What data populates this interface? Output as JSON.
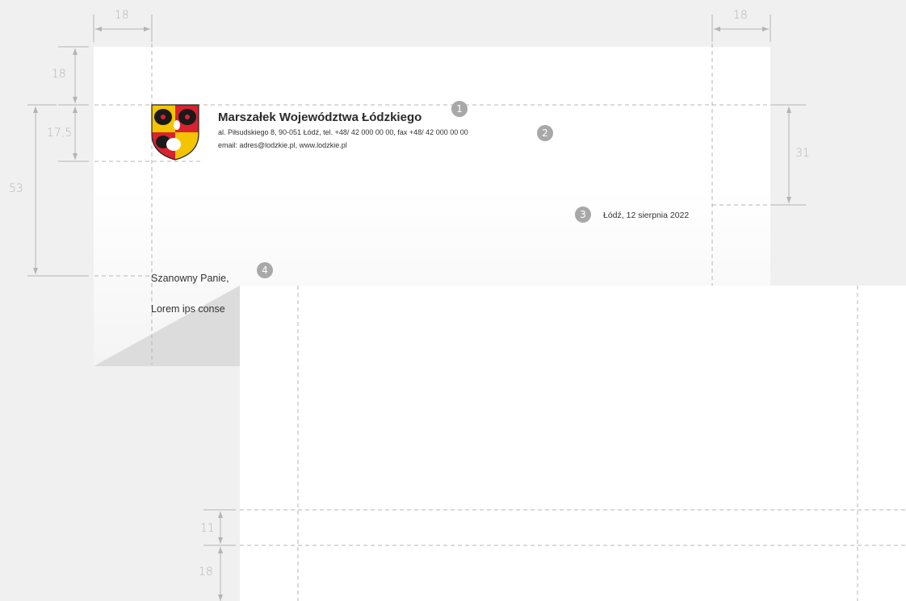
{
  "dimensions": {
    "left_margin_top": "18",
    "right_margin_top": "18",
    "top_margin": "18",
    "header_height": "17,5",
    "salutation_offset": "53",
    "date_offset": "31",
    "footer_gap": "11",
    "bottom_margin": "18"
  },
  "badges": [
    "1",
    "2",
    "3",
    "4"
  ],
  "letterhead": {
    "org_name": "Marszałek Województwa Łódzkiego",
    "address": "al. Piłsudskiego 8, 90-051 Łódź, tel. +48/ 42 000 00 00, fax +48/ 42 000 00 00",
    "contact": "email: adres@lodzkie.pl, www.lodzkie.pl",
    "crest_icon": "coat-of-arms-icon"
  },
  "letter": {
    "date": "Łódź, 12 sierpnia 2022",
    "salutation": "Szanowny Panie,",
    "body_visible": "Lorem ips conse"
  },
  "colors": {
    "background": "#f0f0f0",
    "guide_line": "#b4b4b4",
    "badge": "#a8a8a8",
    "crest_gold": "#f5c400",
    "crest_red": "#d9232e"
  }
}
